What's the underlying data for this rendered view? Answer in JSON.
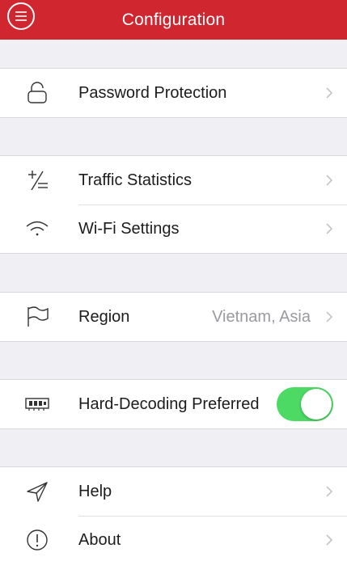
{
  "header": {
    "title": "Configuration",
    "menu_icon": "hamburger-circle-icon",
    "background": "#d0262f"
  },
  "sections": {
    "security": {
      "password": {
        "label": "Password Protection",
        "icon": "lock-icon"
      }
    },
    "network": {
      "traffic": {
        "label": "Traffic Statistics",
        "icon": "plus-minus-icon"
      },
      "wifi": {
        "label": "Wi-Fi Settings",
        "icon": "wifi-icon"
      }
    },
    "location": {
      "region": {
        "label": "Region",
        "value": "Vietnam, Asia",
        "icon": "flag-icon"
      }
    },
    "decoding": {
      "hard_decoding": {
        "label": "Hard-Decoding Preferred",
        "icon": "chip-icon",
        "enabled": true,
        "toggle_color": "#4cd964"
      }
    },
    "info": {
      "help": {
        "label": "Help",
        "icon": "paper-plane-icon"
      },
      "about": {
        "label": "About",
        "icon": "exclamation-circle-icon"
      }
    }
  },
  "chevron_icon": "chevron-right-icon"
}
